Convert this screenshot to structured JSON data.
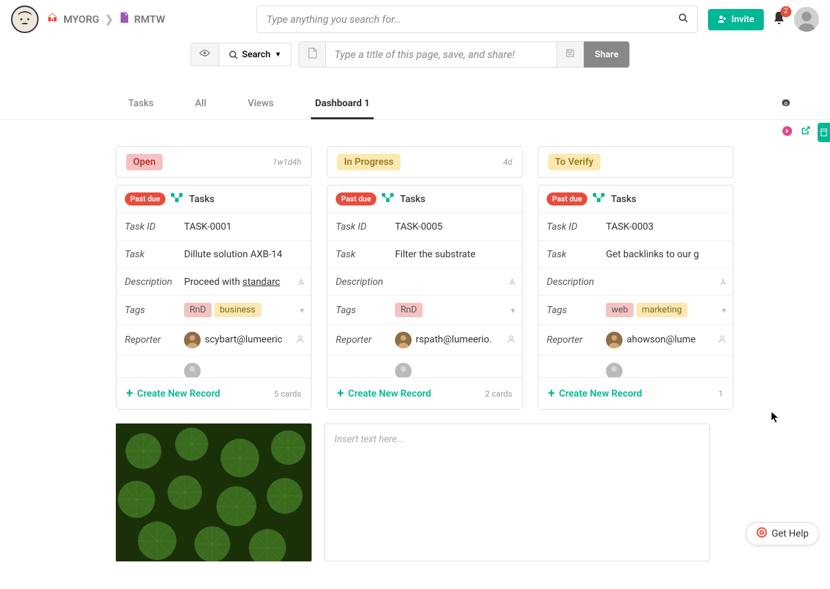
{
  "breadcrumb": {
    "org": "MYORG",
    "project": "RMTW"
  },
  "search": {
    "placeholder": "Type anything you search for…"
  },
  "header": {
    "invite": "Invite",
    "notification_count": "2"
  },
  "toolbar": {
    "search_label": "Search",
    "title_placeholder": "Type a title of this page, save, and share!",
    "share": "Share"
  },
  "tabs": [
    "Tasks",
    "All",
    "Views",
    "Dashboard 1"
  ],
  "active_tab": 3,
  "columns": [
    {
      "status": "Open",
      "status_class": "status-open",
      "time": "1w1d4h",
      "badge": "Past due",
      "section": "Tasks",
      "rows": {
        "task_id": "TASK-0001",
        "task": "Dillute solution AXB-14",
        "description": "Proceed with standarc",
        "tags": [
          {
            "text": "RnD",
            "cls": "tag-rnd"
          },
          {
            "text": "business",
            "cls": "tag-business"
          }
        ],
        "reporter": "scybart@lumeeric"
      },
      "create": "Create New Record",
      "count": "5 cards"
    },
    {
      "status": "In Progress",
      "status_class": "status-progress",
      "time": "4d",
      "badge": "Past due",
      "section": "Tasks",
      "rows": {
        "task_id": "TASK-0005",
        "task": "Filter the substrate",
        "description": "",
        "tags": [
          {
            "text": "RnD",
            "cls": "tag-rnd"
          }
        ],
        "reporter": "rspath@lumeerio."
      },
      "create": "Create New Record",
      "count": "2 cards"
    },
    {
      "status": "To Verify",
      "status_class": "status-verify",
      "time": "",
      "badge": "Past due",
      "section": "Tasks",
      "rows": {
        "task_id": "TASK-0003",
        "task": "Get backlinks to our g",
        "description": "",
        "tags": [
          {
            "text": "web",
            "cls": "tag-web"
          },
          {
            "text": "marketing",
            "cls": "tag-marketing"
          }
        ],
        "reporter": "ahowson@lume"
      },
      "create": "Create New Record",
      "count": "1"
    }
  ],
  "labels": {
    "task_id": "Task ID",
    "task": "Task",
    "description": "Description",
    "tags": "Tags",
    "reporter": "Reporter"
  },
  "text_widget": {
    "placeholder": "Insert text here..."
  },
  "help": "Get Help"
}
